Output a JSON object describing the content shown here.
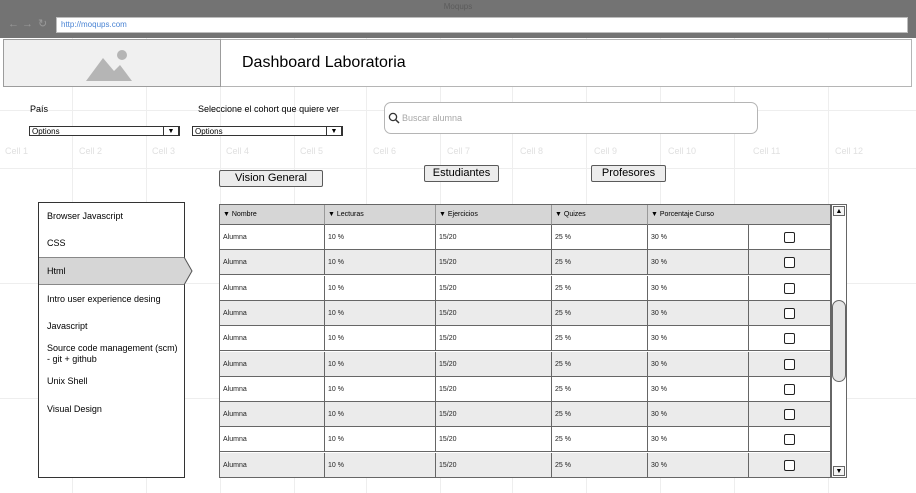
{
  "browser": {
    "title": "Moqups",
    "url": "http://moqups.com",
    "back_icon": "arrow-left-icon",
    "forward_icon": "arrow-right-icon",
    "reload_icon": "reload-icon"
  },
  "grid": {
    "labels": [
      "Cell 1",
      "Cell 2",
      "Cell 3",
      "Cell 4",
      "Cell 5",
      "Cell 6",
      "Cell 7",
      "Cell 8",
      "Cell 9",
      "Cell 10",
      "Cell 11",
      "Cell 12"
    ]
  },
  "header": {
    "logo_icon": "image-placeholder-icon",
    "title": "Dashboard Laboratoria"
  },
  "filters": {
    "country_label": "País",
    "country_value": "Options",
    "cohort_label": "Seleccione el cohort que quiere ver",
    "cohort_value": "Options",
    "search_placeholder": "Buscar alumna",
    "search_icon": "search-icon"
  },
  "buttons": {
    "vision": "Vision General",
    "students": "Estudiantes",
    "teachers": "Profesores"
  },
  "sidebar": {
    "items": [
      "Browser Javascript",
      "CSS",
      "Html",
      "Intro user experience desing",
      "Javascript",
      "Source code management (scm) - git + github",
      "Unix Shell",
      "Visual Design"
    ],
    "active_index": 2
  },
  "table": {
    "columns": [
      "Nombre",
      "Lecturas",
      "Ejercicios",
      "Quizes",
      "Porcentaje Curso"
    ],
    "rows": [
      [
        "Alumna",
        "10 %",
        "15/20",
        "25 %",
        "30 %"
      ],
      [
        "Alumna",
        "10 %",
        "15/20",
        "25 %",
        "30 %"
      ],
      [
        "Alumna",
        "10 %",
        "15/20",
        "25 %",
        "30 %"
      ],
      [
        "Alumna",
        "10 %",
        "15/20",
        "25 %",
        "30 %"
      ],
      [
        "Alumna",
        "10 %",
        "15/20",
        "25 %",
        "30 %"
      ],
      [
        "Alumna",
        "10 %",
        "15/20",
        "25 %",
        "30 %"
      ],
      [
        "Alumna",
        "10 %",
        "15/20",
        "25 %",
        "30 %"
      ],
      [
        "Alumna",
        "10 %",
        "15/20",
        "25 %",
        "30 %"
      ],
      [
        "Alumna",
        "10 %",
        "15/20",
        "25 %",
        "30 %"
      ],
      [
        "Alumna",
        "10 %",
        "15/20",
        "25 %",
        "30 %"
      ]
    ],
    "sort_icon": "sort-down-icon",
    "checkbox_icon": "checkbox-icon"
  },
  "scrollbar": {
    "up_icon": "scroll-up-icon",
    "down_icon": "scroll-down-icon"
  }
}
